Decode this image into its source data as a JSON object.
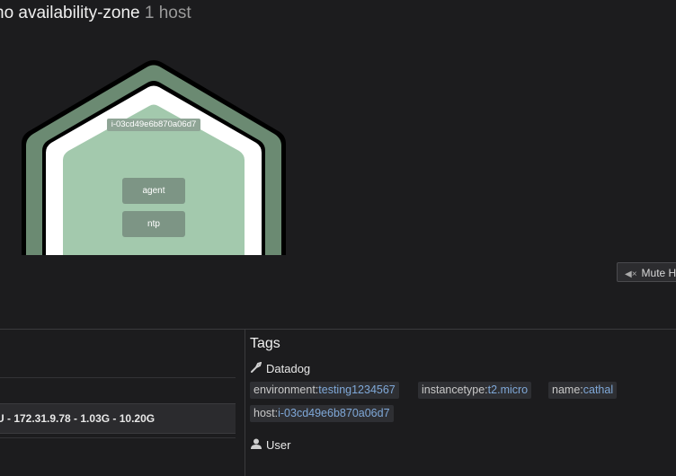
{
  "header": {
    "title": "no availability-zone",
    "count": "1 host"
  },
  "host_map": {
    "host_name": "i-03cd49e6b870a06d7",
    "apps": [
      "agent",
      "ntp"
    ],
    "colors": {
      "outer": "#6b8a72",
      "ring": "#ffffff",
      "inner": "#a3c9ad",
      "outline": "#000000"
    }
  },
  "mute_button": {
    "label": "Mute H",
    "icon": "speaker-mute-icon"
  },
  "details": {
    "ip_row": "U - 172.31.9.78 - 1.03G - 10.20G"
  },
  "tags": {
    "title": "Tags",
    "datadog_label": "Datadog",
    "user_label": "User",
    "items": [
      {
        "key": "environment:",
        "value": "testing1234567"
      },
      {
        "key": "instancetype:",
        "value": "t2.micro"
      },
      {
        "key": "name:",
        "value": "cathal"
      },
      {
        "key": "host:",
        "value": "i-03cd49e6b870a06d7"
      }
    ]
  }
}
